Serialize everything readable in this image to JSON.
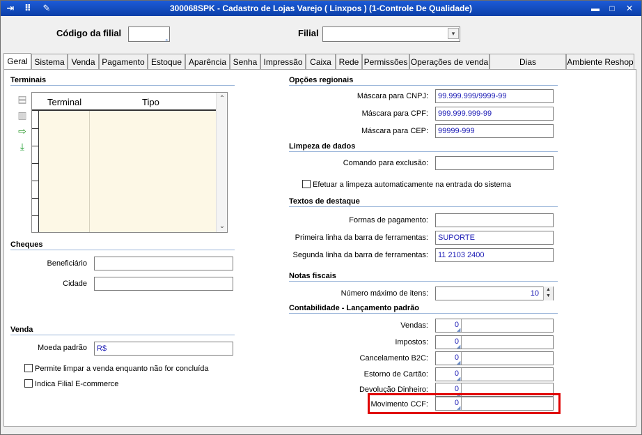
{
  "window": {
    "title": "300068SPK - Cadastro de Lojas Varejo ( Linxpos ) (1-Controle De Qualidade)",
    "icons": [
      "exit-icon",
      "traffic-light-icon",
      "wrench-icon"
    ],
    "controls": {
      "minimize": "▬",
      "maximize": "□",
      "close": "✕"
    }
  },
  "header": {
    "codigo_label": "Código da filial",
    "codigo_value": "",
    "filial_label": "Filial",
    "filial_value": ""
  },
  "tabs": [
    {
      "label": "Geral"
    },
    {
      "label": "Sistema"
    },
    {
      "label": "Venda"
    },
    {
      "label": "Pagamento"
    },
    {
      "label": "Estoque"
    },
    {
      "label": "Aparência"
    },
    {
      "label": "Senha"
    },
    {
      "label": "Impressão"
    },
    {
      "label": "Caixa"
    },
    {
      "label": "Rede"
    },
    {
      "label": "Permissões"
    },
    {
      "label": "Operações de venda"
    },
    {
      "label": "Dias Funcionamento"
    },
    {
      "label": "Ambiente Reshop"
    }
  ],
  "terminais": {
    "section": "Terminais",
    "columns": [
      "Terminal",
      "Tipo"
    ],
    "tools": [
      "add-row-icon",
      "remove-row-icon",
      "export-icon",
      "download-icon"
    ]
  },
  "cheques": {
    "section": "Cheques",
    "beneficiario_label": "Beneficiário",
    "beneficiario_value": "",
    "cidade_label": "Cidade",
    "cidade_value": ""
  },
  "venda": {
    "section": "Venda",
    "moeda_label": "Moeda padrão",
    "moeda_value": "R$",
    "chk_limpar": "Permite limpar a venda enquanto não for concluída",
    "chk_ecommerce": "Indica Filial E-commerce"
  },
  "opcoes": {
    "section": "Opções regionais",
    "cnpj_label": "Máscara para CNPJ:",
    "cnpj_value": "99.999.999/9999-99",
    "cpf_label": "Máscara para CPF:",
    "cpf_value": "999.999.999-99",
    "cep_label": "Máscara para CEP:",
    "cep_value": "99999-999"
  },
  "limpeza": {
    "section": "Limpeza de dados",
    "comando_label": "Comando para exclusão:",
    "comando_value": "",
    "chk_label": "Efetuar a limpeza automaticamente na entrada do sistema"
  },
  "textos": {
    "section": "Textos de destaque",
    "formas_label": "Formas de pagamento:",
    "formas_value": "",
    "primeira_label": "Primeira linha da barra de ferramentas:",
    "primeira_value": "SUPORTE",
    "segunda_label": "Segunda linha da barra de ferramentas:",
    "segunda_value": "11 2103 2400"
  },
  "notas": {
    "section": "Notas fiscais",
    "max_label": "Número máximo de itens:",
    "max_value": "10"
  },
  "contabilidade": {
    "section": "Contabilidade - Lançamento padrão",
    "rows": [
      {
        "label": "Vendas:",
        "value": "0"
      },
      {
        "label": "Impostos:",
        "value": "0"
      },
      {
        "label": "Cancelamento B2C:",
        "value": "0"
      },
      {
        "label": "Estorno de Cartão:",
        "value": "0"
      },
      {
        "label": "Devolução Dinheiro:",
        "value": "0"
      },
      {
        "label": "Movimento CCF:",
        "value": "0"
      }
    ]
  },
  "colors": {
    "titlebar": "#0b3fa8",
    "highlight": "#e00000",
    "value_text": "#1b1bb5"
  }
}
